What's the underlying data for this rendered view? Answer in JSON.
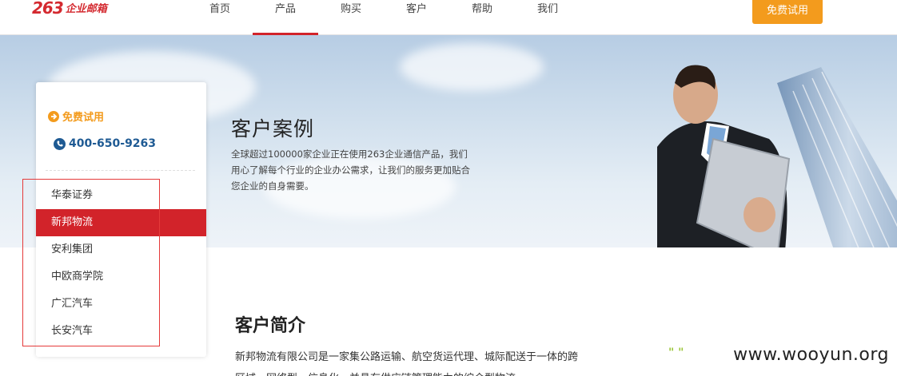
{
  "logo": {
    "mark": "263",
    "text": "企业邮箱"
  },
  "nav": {
    "items": [
      {
        "label": "首页"
      },
      {
        "label": "产品",
        "active": true
      },
      {
        "label": "购买"
      },
      {
        "label": "客户"
      },
      {
        "label": "帮助"
      },
      {
        "label": "我们"
      }
    ],
    "cta_label": "免费试用"
  },
  "hero": {
    "title": "客户案例",
    "description": "全球超过100000家企业正在使用263企业通信产品，我们用心了解每个行业的企业办公需求，让我们的服务更加贴合您企业的自身需要。"
  },
  "sidebar": {
    "trial_label": "免费试用",
    "phone": "400-650-9263",
    "cases": [
      {
        "label": "华泰证券"
      },
      {
        "label": "新邦物流",
        "active": true
      },
      {
        "label": "安利集团"
      },
      {
        "label": "中欧商学院"
      },
      {
        "label": "广汇汽车"
      },
      {
        "label": "长安汽车"
      }
    ]
  },
  "intro": {
    "title": "客户简介",
    "text": "新邦物流有限公司是一家集公路运输、航空货运代理、城际配送于一体的跨区域、网络型、信息化，并具有供应链管理能力的综合型物流"
  },
  "watermark": "www.wooyun.org",
  "colors": {
    "accent_red": "#d2232a",
    "cta_orange": "#f39b1d",
    "phone_blue": "#1e5a93",
    "highlight_box": "#e53a3a"
  }
}
